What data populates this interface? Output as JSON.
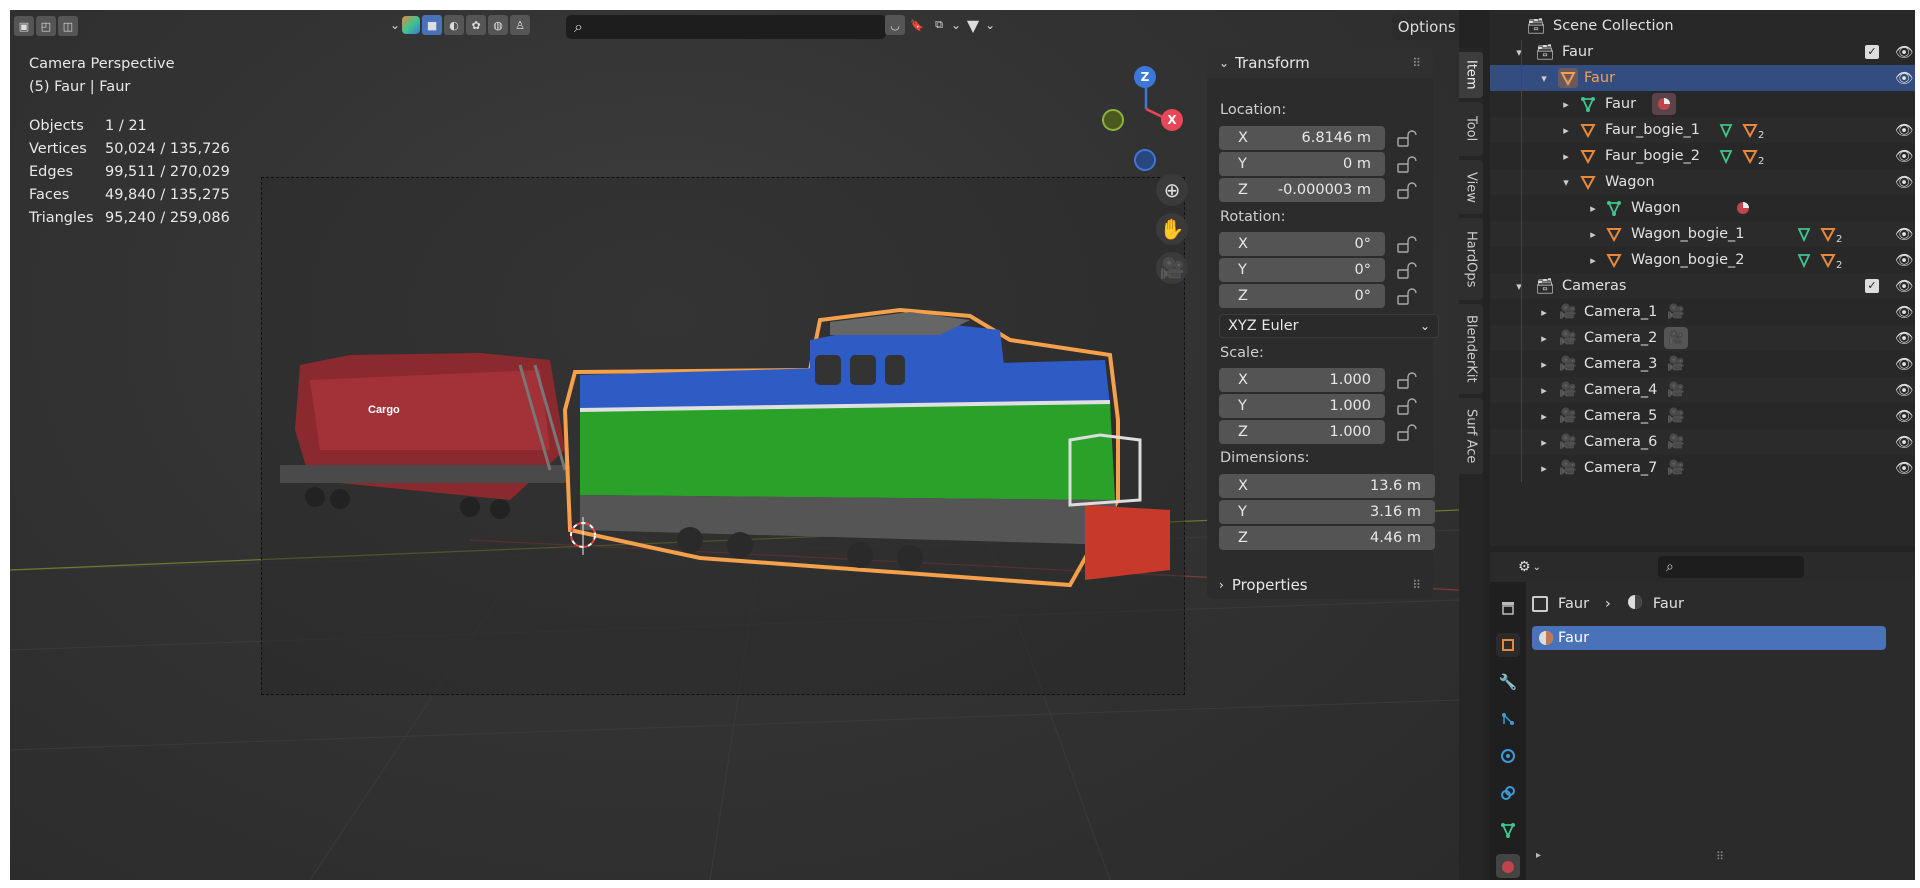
{
  "viewport": {
    "header": {
      "search_placeholder": "",
      "options_label": "Options"
    },
    "overlay": {
      "view_name": "Camera Perspective",
      "object_info": "(5) Faur | Faur",
      "stats": [
        {
          "key": "Objects",
          "value": "1 / 21"
        },
        {
          "key": "Vertices",
          "value": "50,024 / 135,726"
        },
        {
          "key": "Edges",
          "value": "99,511 / 270,029"
        },
        {
          "key": "Faces",
          "value": "49,840 / 135,275"
        },
        {
          "key": "Triangles",
          "value": "95,240 / 259,086"
        }
      ]
    },
    "gizmo": {
      "z": "Z",
      "x": "X"
    },
    "model_text": {
      "cargo": "Cargo"
    }
  },
  "npanel": {
    "transform_title": "Transform",
    "location_label": "Location:",
    "location": [
      {
        "axis": "X",
        "value": "6.8146 m"
      },
      {
        "axis": "Y",
        "value": "0 m"
      },
      {
        "axis": "Z",
        "value": "-0.000003 m"
      }
    ],
    "rotation_label": "Rotation:",
    "rotation": [
      {
        "axis": "X",
        "value": "0°"
      },
      {
        "axis": "Y",
        "value": "0°"
      },
      {
        "axis": "Z",
        "value": "0°"
      }
    ],
    "rotation_mode": "XYZ Euler",
    "scale_label": "Scale:",
    "scale": [
      {
        "axis": "X",
        "value": "1.000"
      },
      {
        "axis": "Y",
        "value": "1.000"
      },
      {
        "axis": "Z",
        "value": "1.000"
      }
    ],
    "dimensions_label": "Dimensions:",
    "dimensions": [
      {
        "axis": "X",
        "value": "13.6 m"
      },
      {
        "axis": "Y",
        "value": "3.16 m"
      },
      {
        "axis": "Z",
        "value": "4.46 m"
      }
    ],
    "properties_title": "Properties"
  },
  "sidetabs": [
    "Item",
    "Tool",
    "View",
    "HardOps",
    "BlenderKit",
    "Surf Ace"
  ],
  "outliner": {
    "rows": [
      {
        "label": "Scene Collection"
      },
      {
        "label": "Faur"
      },
      {
        "label": "Faur"
      },
      {
        "label": "Faur"
      },
      {
        "label": "Faur_bogie_1",
        "sub": "2"
      },
      {
        "label": "Faur_bogie_2",
        "sub": "2"
      },
      {
        "label": "Wagon"
      },
      {
        "label": "Wagon"
      },
      {
        "label": "Wagon_bogie_1",
        "sub": "2"
      },
      {
        "label": "Wagon_bogie_2",
        "sub": "2"
      },
      {
        "label": "Cameras"
      },
      {
        "label": "Camera_1"
      },
      {
        "label": "Camera_2"
      },
      {
        "label": "Camera_3"
      },
      {
        "label": "Camera_4"
      },
      {
        "label": "Camera_5"
      },
      {
        "label": "Camera_6"
      },
      {
        "label": "Camera_7"
      }
    ]
  },
  "properties": {
    "search_placeholder": "",
    "breadcrumb": {
      "object": "Faur",
      "material": "Faur"
    },
    "material_slot": "Faur"
  },
  "colors": {
    "selection": "#334d80",
    "active_text": "#f5a04a",
    "mesh_orange": "#e8883a",
    "data_green": "#3fc58e",
    "slot_blue": "#4a72b8",
    "axis_x": "#e8475a",
    "axis_z": "#3b78d8",
    "axis_y": "#8cb33a"
  }
}
